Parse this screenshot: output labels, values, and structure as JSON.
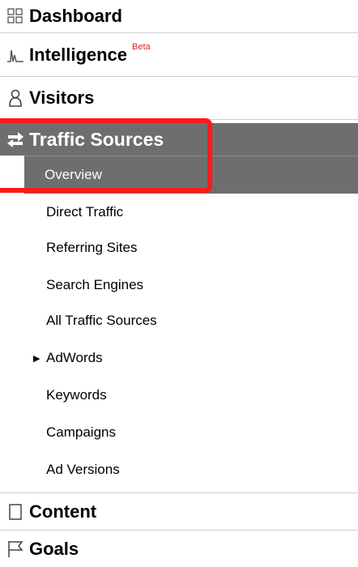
{
  "nav": {
    "sections": {
      "dashboard": {
        "label": "Dashboard",
        "icon": "grid-icon"
      },
      "intelligence": {
        "label": "Intelligence",
        "badge": "Beta",
        "icon": "pulse-icon"
      },
      "visitors": {
        "label": "Visitors",
        "icon": "person-icon"
      },
      "traffic_sources": {
        "label": "Traffic Sources",
        "icon": "arrows-icon"
      },
      "content": {
        "label": "Content",
        "icon": "page-icon"
      },
      "goals": {
        "label": "Goals",
        "icon": "flag-icon"
      }
    },
    "traffic_items": [
      "Overview",
      "Direct Traffic",
      "Referring Sites",
      "Search Engines",
      "All Traffic Sources",
      "AdWords",
      "Keywords",
      "Campaigns",
      "Ad Versions"
    ],
    "colors": {
      "active_bg": "#6e6e6e",
      "highlight": "#ff1a1a",
      "beta": "#e02020"
    }
  }
}
